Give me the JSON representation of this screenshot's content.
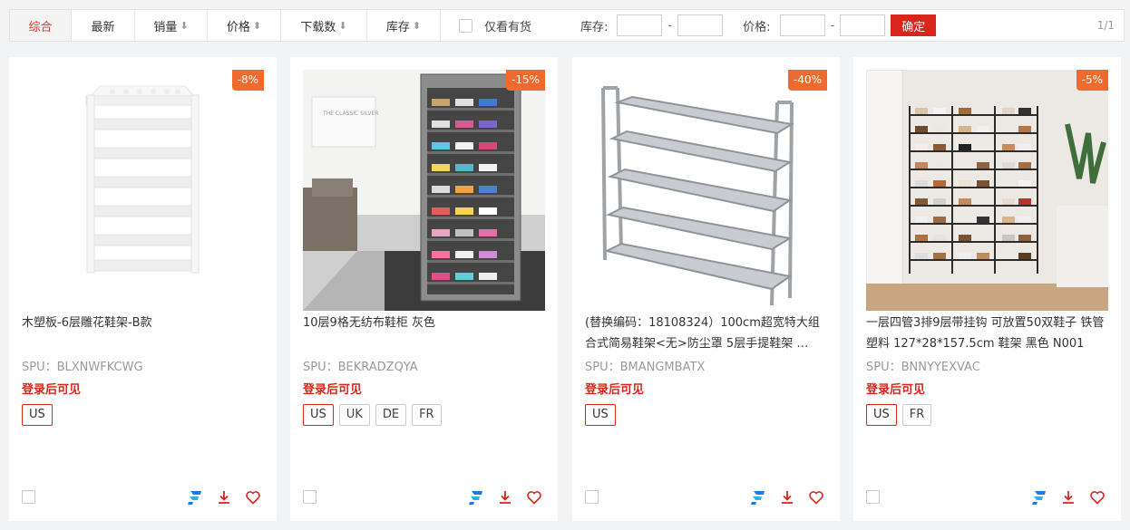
{
  "sort_tabs": [
    {
      "label": "综合",
      "arrow": ""
    },
    {
      "label": "最新",
      "arrow": ""
    },
    {
      "label": "销量",
      "arrow": "⬇"
    },
    {
      "label": "价格",
      "arrow": "⬍"
    },
    {
      "label": "下载数",
      "arrow": "⬇"
    },
    {
      "label": "库存",
      "arrow": "⬍"
    }
  ],
  "filters": {
    "in_stock_label": "仅看有货",
    "stock_label": "库存:",
    "price_label": "价格:",
    "dash": "-",
    "confirm_label": "确定",
    "page_count": "1/1"
  },
  "colors": {
    "accent": "#d9261c",
    "discount_badge": "#f06a2b",
    "brand_icon": "#1e7be6"
  },
  "products": [
    {
      "discount": "-8%",
      "title": "木塑板-6层雕花鞋架-B款",
      "spu": "SPU：BLXNWFKCWG",
      "login_text": "登录后可见",
      "tags": [
        "US"
      ]
    },
    {
      "discount": "-15%",
      "title": "10层9格无纺布鞋柜 灰色",
      "spu": "SPU：BEKRADZQYA",
      "login_text": "登录后可见",
      "tags": [
        "US",
        "UK",
        "DE",
        "FR"
      ]
    },
    {
      "discount": "-40%",
      "title": "(替换编码：18108324）100cm超宽特大组合式简易鞋架<无>防尘罩 5层手提鞋架 …",
      "spu": "SPU：BMANGMBATX",
      "login_text": "登录后可见",
      "tags": [
        "US"
      ]
    },
    {
      "discount": "-5%",
      "title": "一层四管3排9层带挂钩 可放置50双鞋子 铁管 塑料 127*28*157.5cm 鞋架 黑色 N001",
      "spu": "SPU：BNNYYEXVAC",
      "login_text": "登录后可见",
      "tags": [
        "US",
        "FR"
      ]
    }
  ],
  "image_texts": {
    "poster": "THE CLASSIC SILVER"
  }
}
